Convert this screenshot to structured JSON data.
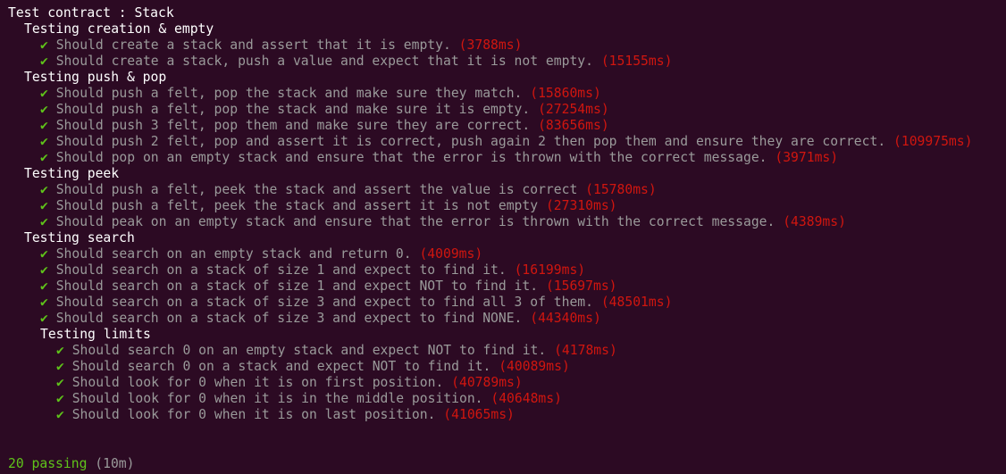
{
  "title": "Test contract : Stack",
  "suites": [
    {
      "name": "Testing creation & empty",
      "tests": [
        {
          "desc": "Should create a stack and assert that it is empty.",
          "dur": "(3788ms)"
        },
        {
          "desc": "Should create a stack, push a value and expect that it is not empty.",
          "dur": "(15155ms)"
        }
      ]
    },
    {
      "name": "Testing push & pop",
      "tests": [
        {
          "desc": "Should push a felt, pop the stack and make sure they match.",
          "dur": "(15860ms)"
        },
        {
          "desc": "Should push a felt, pop the stack and make sure it is empty.",
          "dur": "(27254ms)"
        },
        {
          "desc": "Should push 3 felt, pop them and make sure they are correct.",
          "dur": "(83656ms)"
        },
        {
          "desc": "Should push 2 felt, pop and assert it is correct, push again 2 then pop them and ensure they are correct.",
          "dur": "(109975ms)"
        },
        {
          "desc": "Should pop on an empty stack and ensure that the error is thrown with the correct message.",
          "dur": "(3971ms)"
        }
      ]
    },
    {
      "name": "Testing peek",
      "tests": [
        {
          "desc": "Should push a felt, peek the stack and assert the value is correct",
          "dur": "(15780ms)"
        },
        {
          "desc": "Should push a felt, peek the stack and assert it is not empty",
          "dur": "(27310ms)"
        },
        {
          "desc": "Should peak on an empty stack and ensure that the error is thrown with the correct message.",
          "dur": "(4389ms)"
        }
      ]
    },
    {
      "name": "Testing search",
      "tests": [
        {
          "desc": "Should search on an empty stack and return 0.",
          "dur": "(4009ms)"
        },
        {
          "desc": "Should search on a stack of size 1 and expect to find it.",
          "dur": "(16199ms)"
        },
        {
          "desc": "Should search on a stack of size 1 and expect NOT to find it.",
          "dur": "(15697ms)"
        },
        {
          "desc": "Should search on a stack of size 3 and expect to find all 3 of them.",
          "dur": "(48501ms)"
        },
        {
          "desc": "Should search on a stack of size 3 and expect to find NONE.",
          "dur": "(44340ms)"
        }
      ]
    },
    {
      "name": "Testing limits",
      "nested": true,
      "tests": [
        {
          "desc": "Should search 0 on an empty stack and expect NOT to find it.",
          "dur": "(4178ms)"
        },
        {
          "desc": "Should search 0 on a stack and expect NOT to find it.",
          "dur": "(40089ms)"
        },
        {
          "desc": "Should look for 0 when it is on first position.",
          "dur": "(40789ms)"
        },
        {
          "desc": "Should look for 0 when it is in the middle position.",
          "dur": "(40648ms)"
        },
        {
          "desc": "Should look for 0 when it is on last position.",
          "dur": "(41065ms)"
        }
      ]
    }
  ],
  "summary": {
    "passing": "20 passing",
    "elapsed": "(10m)"
  },
  "check_glyph": "✔",
  "colors": {
    "background": "#2c0a23",
    "check": "#5fc41a",
    "duration": "#d0160f",
    "description": "#9a9a9a",
    "heading": "#ffffff"
  },
  "icons": {
    "check": "check-icon"
  }
}
